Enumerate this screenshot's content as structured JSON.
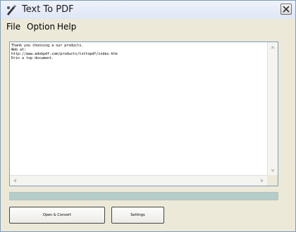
{
  "window": {
    "title": "Text To PDF",
    "close_glyph": "×",
    "accent_color": "#7f9db9"
  },
  "menu": {
    "items": [
      {
        "label": "File"
      },
      {
        "label": "Option"
      },
      {
        "label": "Help"
      }
    ]
  },
  "editor": {
    "lines": [
      "Thank you choosing a our products.",
      "Web at:",
      "http://www.adobpdf.com/products/txttopdf/index.htm",
      "Drin a top document."
    ]
  },
  "progress": {
    "value_percent": 100,
    "fill_color": "#b4cdc8"
  },
  "buttons": {
    "open_convert": "Open & Convert",
    "settings": "Settings"
  },
  "icons": {
    "app": "pen-icon",
    "close": "close-icon"
  }
}
